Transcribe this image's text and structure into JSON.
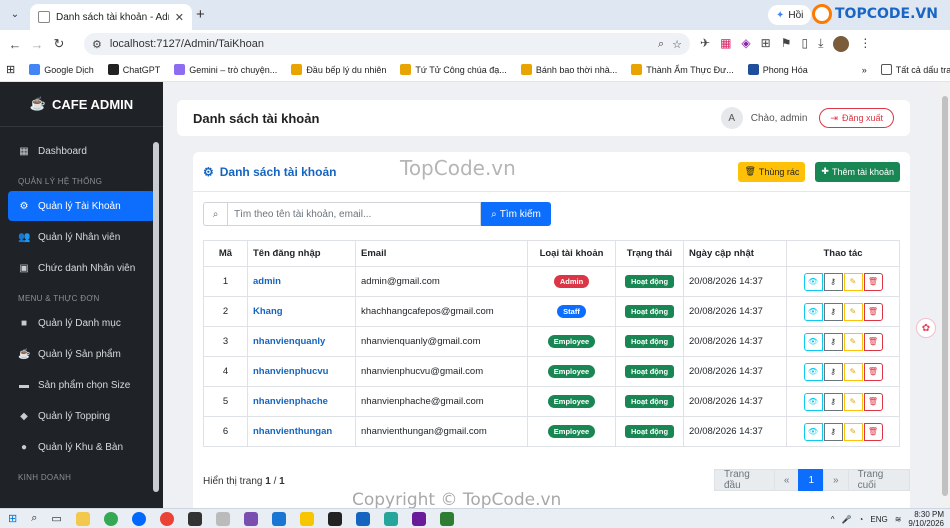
{
  "browser": {
    "tab_title": "Danh sách tài khoản - Admin C",
    "url": "localhost:7127/Admin/TaiKhoan",
    "ext_label": "Hồi",
    "brand_logo": "TOPCODE.VN",
    "bookmarks": [
      {
        "label": "Google Dịch",
        "color": "#4285f4"
      },
      {
        "label": "ChatGPT",
        "color": "#222222"
      },
      {
        "label": "Gemini – trò chuyện...",
        "color": "#8e6cf0"
      },
      {
        "label": "Đầu bếp lý du nhiên",
        "color": "#e8a400"
      },
      {
        "label": "Tứ Tử Công chúa đạ...",
        "color": "#e8a400"
      },
      {
        "label": "Bánh bao thời nhà...",
        "color": "#e8a400"
      },
      {
        "label": "Thành Ẩm Thực Đư...",
        "color": "#e8a400"
      },
      {
        "label": "Phong Hóa",
        "color": "#1f4e9a"
      }
    ],
    "all_bookmarks": "Tất cả dấu trang"
  },
  "sidebar": {
    "brand": "CAFE ADMIN",
    "items": [
      {
        "label": "Dashboard",
        "icon": "dashboard-icon",
        "glyph": "▦"
      },
      {
        "section": "QUẢN LÝ HỆ THỐNG"
      },
      {
        "label": "Quản lý Tài Khoản",
        "icon": "users-cog-icon",
        "glyph": "⚙",
        "active": true
      },
      {
        "label": "Quản lý Nhân viên",
        "icon": "users-icon",
        "glyph": "👥"
      },
      {
        "label": "Chức danh Nhân viên",
        "icon": "id-badge-icon",
        "glyph": "▣"
      },
      {
        "section": "MENU & THỰC ĐƠN"
      },
      {
        "label": "Quản lý Danh mục",
        "icon": "folder-icon",
        "glyph": "■"
      },
      {
        "label": "Quản lý Sản phẩm",
        "icon": "mug-icon",
        "glyph": "☕"
      },
      {
        "label": "Sản phẩm chọn Size",
        "icon": "resize-icon",
        "glyph": "▬"
      },
      {
        "label": "Quản lý Topping",
        "icon": "layers-icon",
        "glyph": "◆"
      },
      {
        "label": "Quản lý Khu & Bàn",
        "icon": "map-marker-icon",
        "glyph": "●"
      },
      {
        "section": "KINH DOANH"
      }
    ]
  },
  "header": {
    "title": "Danh sách tài khoản",
    "avatar_letter": "A",
    "greeting": "Chào, admin",
    "logout": "Đăng xuất"
  },
  "card": {
    "title": "Danh sách tài khoản",
    "trash_btn": "Thùng rác",
    "add_btn": "Thêm tài khoản",
    "search_placeholder": "Tìm theo tên tài khoản, email...",
    "search_btn": "Tìm kiếm"
  },
  "table": {
    "headers": [
      "Mã",
      "Tên đăng nhập",
      "Email",
      "Loại tài khoản",
      "Trạng thái",
      "Ngày cập nhật",
      "Thao tác"
    ],
    "rows": [
      {
        "id": "1",
        "username": "admin",
        "email": "admin@gmail.com",
        "role": "Admin",
        "role_class": "b-admin",
        "status": "Hoạt động",
        "updated": "20/08/2026 14:37"
      },
      {
        "id": "2",
        "username": "Khang",
        "email": "khachhangcafepos@gmail.com",
        "role": "Staff",
        "role_class": "b-staff",
        "status": "Hoạt động",
        "updated": "20/08/2026 14:37"
      },
      {
        "id": "3",
        "username": "nhanvienquanly",
        "email": "nhanvienquanly@gmail.com",
        "role": "Employee",
        "role_class": "b-emp",
        "status": "Hoạt động",
        "updated": "20/08/2026 14:37"
      },
      {
        "id": "4",
        "username": "nhanvienphucvu",
        "email": "nhanvienphucvu@gmail.com",
        "role": "Employee",
        "role_class": "b-emp",
        "status": "Hoạt động",
        "updated": "20/08/2026 14:37"
      },
      {
        "id": "5",
        "username": "nhanvienphache",
        "email": "nhanvienphache@gmail.com",
        "role": "Employee",
        "role_class": "b-emp",
        "status": "Hoạt động",
        "updated": "20/08/2026 14:37"
      },
      {
        "id": "6",
        "username": "nhanvienthungan",
        "email": "nhanvienthungan@gmail.com",
        "role": "Employee",
        "role_class": "b-emp",
        "status": "Hoạt động",
        "updated": "20/08/2026 14:37"
      }
    ]
  },
  "pagination": {
    "info_prefix": "Hiển thị trang",
    "current": "1",
    "total": "1",
    "first": "Trang đầu",
    "prev": "«",
    "page": "1",
    "next": "»",
    "last": "Trang cuối"
  },
  "taskbar": {
    "lang": "ENG",
    "time": "8:30 PM",
    "date": "9/10/2026"
  },
  "watermarks": {
    "center": "TopCode.vn",
    "bottom": "Copyright © TopCode.vn"
  }
}
